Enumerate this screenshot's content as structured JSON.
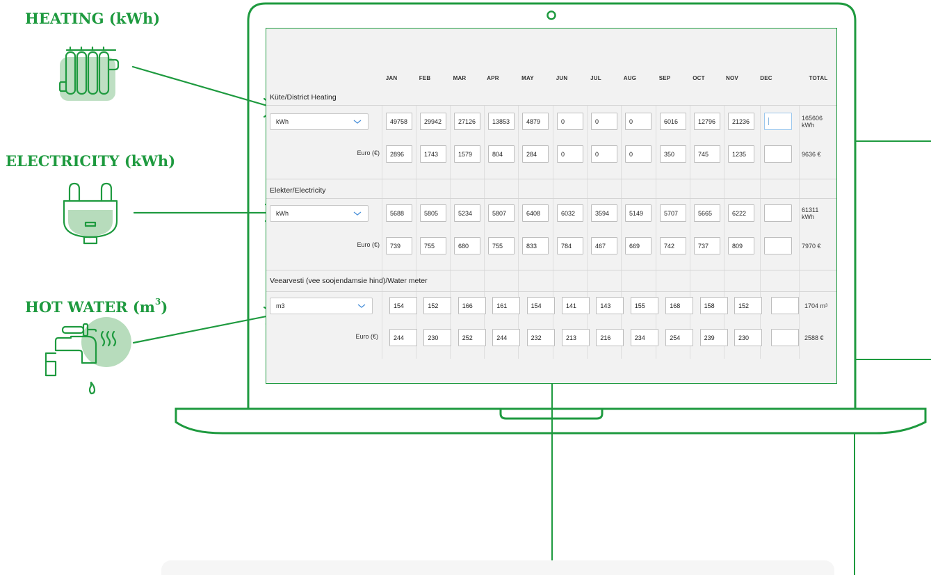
{
  "labels": {
    "heating": "HEATING (kWh)",
    "electricity": "ELECTRICITY (kWh)",
    "hot_water": "HOT WATER (m",
    "hot_water_sup": "3",
    "hot_water_close": ")"
  },
  "colors": {
    "accent": "#1e9a3f",
    "accent_light": "#b7dcbc",
    "select_chevron": "#4a90d9"
  },
  "icons": [
    "radiator-icon",
    "plug-icon",
    "tap-icon",
    "chevron-down-icon"
  ],
  "screen": {
    "months": [
      "JAN",
      "FEB",
      "MAR",
      "APR",
      "MAY",
      "JUN",
      "JUL",
      "AUG",
      "SEP",
      "OCT",
      "NOV",
      "DEC"
    ],
    "total_header": "TOTAL",
    "euro_label": "Euro (€)",
    "sections": [
      {
        "title": "Küte/District Heating",
        "unit": "kWh",
        "amount": [
          "49758",
          "29942",
          "27126",
          "13853",
          "4879",
          "0",
          "0",
          "0",
          "6016",
          "12796",
          "21236",
          ""
        ],
        "amount_total": "165606",
        "amount_total_unit": "kWh",
        "euro": [
          "2896",
          "1743",
          "1579",
          "804",
          "284",
          "0",
          "0",
          "0",
          "350",
          "745",
          "1235",
          ""
        ],
        "euro_total": "9636 €"
      },
      {
        "title": "Elekter/Electricity",
        "unit": "kWh",
        "amount": [
          "5688",
          "5805",
          "5234",
          "5807",
          "6408",
          "6032",
          "3594",
          "5149",
          "5707",
          "5665",
          "6222",
          ""
        ],
        "amount_total": "61311",
        "amount_total_unit": "kWh",
        "euro": [
          "739",
          "755",
          "680",
          "755",
          "833",
          "784",
          "467",
          "669",
          "742",
          "737",
          "809",
          ""
        ],
        "euro_total": "7970 €"
      },
      {
        "title": "Veearvesti (vee soojendamsie hind)/Water meter",
        "unit": "m3",
        "amount": [
          "154",
          "152",
          "166",
          "161",
          "154",
          "141",
          "143",
          "155",
          "168",
          "158",
          "152",
          ""
        ],
        "amount_total": "1704 m",
        "amount_total_sup": "3",
        "euro": [
          "244",
          "230",
          "252",
          "244",
          "232",
          "213",
          "216",
          "234",
          "254",
          "239",
          "230",
          ""
        ],
        "euro_total": "2588 €"
      }
    ]
  }
}
